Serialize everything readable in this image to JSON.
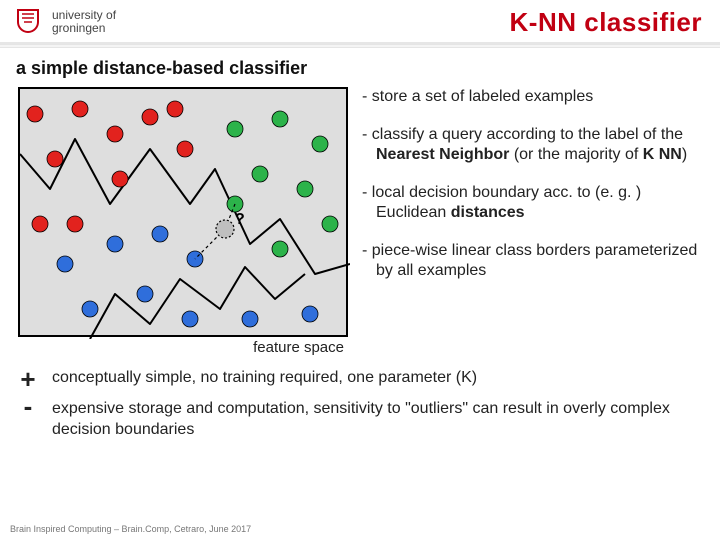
{
  "header": {
    "affiliation_line1": "university of",
    "affiliation_line2": "groningen",
    "title": "K-NN classifier"
  },
  "subtitle": "a simple distance-based classifier",
  "bullets": {
    "b1": "- store a set of labeled examples",
    "b2_pre": "- classify a query according to the label of the ",
    "b2_nn": "Nearest Neighbor",
    "b2_mid": " (or the majority of ",
    "b2_knn": "K NN",
    "b2_post": ")",
    "b3_pre": "- local decision boundary acc. to (e. g. ) Euclidean ",
    "b3_dist": "distances",
    "b4": "- piece-wise linear class borders parameterized by all examples"
  },
  "diagram": {
    "feature_space_label": "feature space",
    "query_mark": "?"
  },
  "proscons": {
    "plus_sign": "+",
    "minus_sign": "-",
    "pro": "conceptually simple, no training required, one parameter (K)",
    "con": "expensive storage and computation, sensitivity to \"outliers\" can result in overly complex decision boundaries"
  },
  "footer": "Brain Inspired Computing – Brain.Comp, Cetraro, June 2017"
}
